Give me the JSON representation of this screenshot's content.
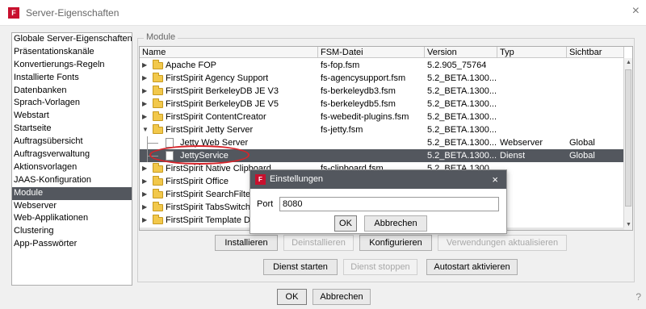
{
  "window": {
    "title": "Server-Eigenschaften",
    "icon_letter": "F",
    "close_glyph": "×"
  },
  "sidebar": {
    "items": [
      {
        "label": "Globale Server-Eigenschaften",
        "selected": false
      },
      {
        "label": "Präsentationskanäle",
        "selected": false
      },
      {
        "label": "Konvertierungs-Regeln",
        "selected": false
      },
      {
        "label": "Installierte Fonts",
        "selected": false
      },
      {
        "label": "Datenbanken",
        "selected": false
      },
      {
        "label": "Sprach-Vorlagen",
        "selected": false
      },
      {
        "label": "Webstart",
        "selected": false
      },
      {
        "label": "Startseite",
        "selected": false
      },
      {
        "label": "Auftragsübersicht",
        "selected": false
      },
      {
        "label": "Auftragsverwaltung",
        "selected": false
      },
      {
        "label": "Aktionsvorlagen",
        "selected": false
      },
      {
        "label": "JAAS-Konfiguration",
        "selected": false
      },
      {
        "label": "Module",
        "selected": true
      },
      {
        "label": "Webserver",
        "selected": false
      },
      {
        "label": "Web-Applikationen",
        "selected": false
      },
      {
        "label": "Clustering",
        "selected": false
      },
      {
        "label": "App-Passwörter",
        "selected": false
      }
    ]
  },
  "modules": {
    "group_title": "Module",
    "columns": [
      "Name",
      "FSM-Datei",
      "Version",
      "Typ",
      "Sichtbar"
    ],
    "rows": [
      {
        "name": "Apache FOP",
        "fsm": "fs-fop.fsm",
        "version": "5.2.905_75764",
        "typ": "",
        "sichtbar": "",
        "kind": "folder",
        "expand": "▶",
        "level": 0
      },
      {
        "name": "FirstSpirit Agency Support",
        "fsm": "fs-agencysupport.fsm",
        "version": "5.2_BETA.1300...",
        "typ": "",
        "sichtbar": "",
        "kind": "folder",
        "expand": "▶",
        "level": 0
      },
      {
        "name": "FirstSpirit BerkeleyDB JE V3",
        "fsm": "fs-berkeleydb3.fsm",
        "version": "5.2_BETA.1300...",
        "typ": "",
        "sichtbar": "",
        "kind": "folder",
        "expand": "▶",
        "level": 0
      },
      {
        "name": "FirstSpirit BerkeleyDB JE V5",
        "fsm": "fs-berkeleydb5.fsm",
        "version": "5.2_BETA.1300...",
        "typ": "",
        "sichtbar": "",
        "kind": "folder",
        "expand": "▶",
        "level": 0
      },
      {
        "name": "FirstSpirit ContentCreator",
        "fsm": "fs-webedit-plugins.fsm",
        "version": "5.2_BETA.1300...",
        "typ": "",
        "sichtbar": "",
        "kind": "folder",
        "expand": "▶",
        "level": 0
      },
      {
        "name": "FirstSpirit Jetty Server",
        "fsm": "fs-jetty.fsm",
        "version": "5.2_BETA.1300...",
        "typ": "",
        "sichtbar": "",
        "kind": "folder-open",
        "expand": "▼",
        "level": 0
      },
      {
        "name": "Jetty Web Server",
        "fsm": "",
        "version": "5.2_BETA.1300...",
        "typ": "Webserver",
        "sichtbar": "Global",
        "kind": "file",
        "expand": "",
        "level": 1
      },
      {
        "name": "JettyService",
        "fsm": "",
        "version": "5.2_BETA.1300...",
        "typ": "Dienst",
        "sichtbar": "Global",
        "kind": "file",
        "expand": "",
        "level": 1,
        "selected": true
      },
      {
        "name": "FirstSpirit Native Clipboard",
        "fsm": "fs-clipboard.fsm",
        "version": "5.2_BETA.1300...",
        "typ": "",
        "sichtbar": "",
        "kind": "folder",
        "expand": "▶",
        "level": 0
      },
      {
        "name": "FirstSpirit Office",
        "fsm": "",
        "version": "",
        "typ": "",
        "sichtbar": "",
        "kind": "folder",
        "expand": "▶",
        "level": 0
      },
      {
        "name": "FirstSpirit SearchFilter",
        "fsm": "",
        "version": "",
        "typ": "",
        "sichtbar": "",
        "kind": "folder",
        "expand": "▶",
        "level": 0
      },
      {
        "name": "FirstSpirit TabsSwitch",
        "fsm": "",
        "version": "",
        "typ": "",
        "sichtbar": "",
        "kind": "folder",
        "expand": "▶",
        "level": 0
      },
      {
        "name": "FirstSpirit Template D",
        "fsm": "",
        "version": "",
        "typ": "",
        "sichtbar": "",
        "kind": "folder",
        "expand": "▶",
        "level": 0
      }
    ]
  },
  "buttons": {
    "install": "Installieren",
    "uninstall": "Deinstallieren",
    "configure": "Konfigurieren",
    "update_usages": "Verwendungen aktualisieren",
    "start_service": "Dienst starten",
    "stop_service": "Dienst stoppen",
    "autostart": "Autostart aktivieren",
    "ok": "OK",
    "cancel": "Abbrechen"
  },
  "popup": {
    "title": "Einstellungen",
    "icon_letter": "F",
    "close_glyph": "×",
    "port_label": "Port",
    "port_value": "8080",
    "ok": "OK",
    "cancel": "Abbrechen"
  },
  "help_glyph": "?"
}
